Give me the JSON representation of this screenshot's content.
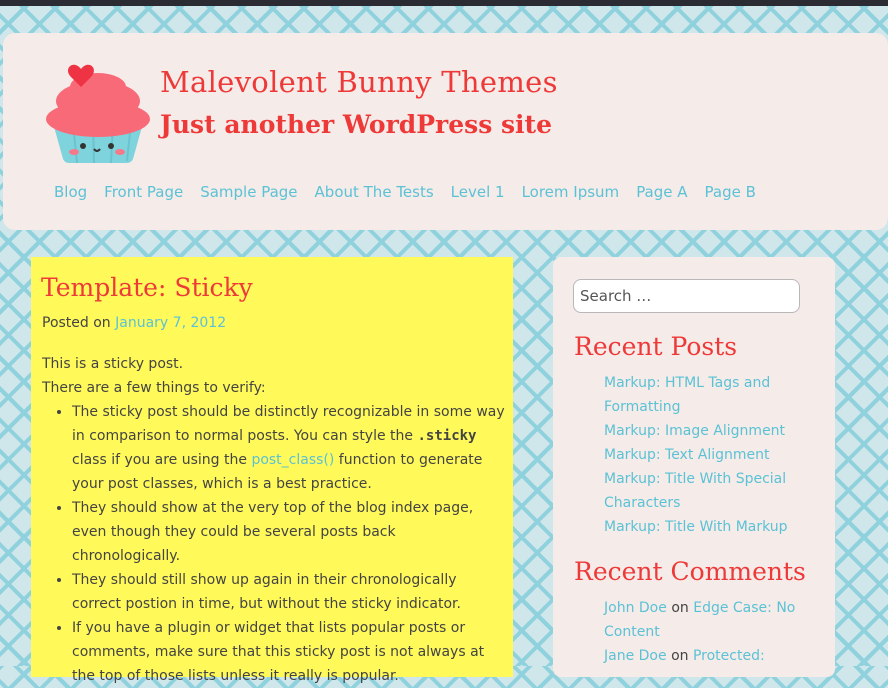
{
  "site": {
    "title": "Malevolent Bunny Themes",
    "tagline": "Just another WordPress site"
  },
  "nav": [
    {
      "label": "Blog"
    },
    {
      "label": "Front Page"
    },
    {
      "label": "Sample Page"
    },
    {
      "label": "About The Tests"
    },
    {
      "label": "Level 1"
    },
    {
      "label": "Lorem Ipsum"
    },
    {
      "label": "Page A"
    },
    {
      "label": "Page B"
    }
  ],
  "post": {
    "title": "Template: Sticky",
    "posted_on": "Posted on",
    "date": "January 7, 2012",
    "intro1": "This is a sticky post.",
    "intro2": "There are a few things to verify:",
    "bullets": [
      {
        "a": "The sticky post should be distinctly recognizable in some way in comparison to normal posts. You can style the ",
        "code": ".sticky",
        "b": " class if you are using the ",
        "link": "post_class()",
        "c": " function to generate your post classes, which is a best practice."
      },
      {
        "text": "They should show at the very top of the blog index page, even though they could be several posts back chronologically."
      },
      {
        "text": "They should still show up again in their chronologically correct postion in time, but without the sticky indicator."
      },
      {
        "text": "If you have a plugin or widget that lists popular posts or comments, make sure that this sticky post is not always at the top of those lists unless it really is popular."
      }
    ]
  },
  "sidebar": {
    "search_placeholder": "Search …",
    "recent_posts_title": "Recent Posts",
    "recent_posts": [
      "Markup: HTML Tags and Formatting",
      "Markup: Image Alignment",
      "Markup: Text Alignment",
      "Markup: Title With Special Characters",
      "Markup: Title With Markup"
    ],
    "recent_comments_title": "Recent Comments",
    "recent_comments": [
      {
        "author": "John Doe",
        "on": "on",
        "post": "Edge Case: No Content"
      },
      {
        "author": "Jane Doe",
        "on": "on",
        "post": "Protected:"
      }
    ]
  },
  "colors": {
    "accent": "#ee3939",
    "link": "#5bc2d6",
    "post_bg": "#fff95a",
    "panel_bg": "#f5ebe8"
  },
  "icons": {
    "logo": "cupcake-icon"
  }
}
